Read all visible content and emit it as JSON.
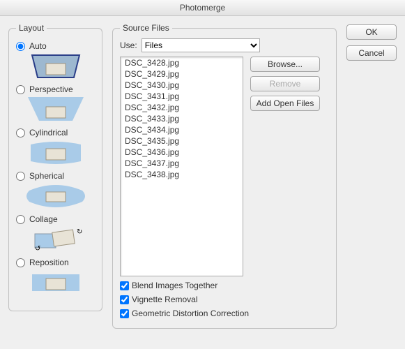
{
  "window": {
    "title": "Photomerge"
  },
  "buttons": {
    "ok": "OK",
    "cancel": "Cancel"
  },
  "layout": {
    "legend": "Layout",
    "options": {
      "auto": {
        "label": "Auto",
        "selected": true
      },
      "perspective": {
        "label": "Perspective",
        "selected": false
      },
      "cylindrical": {
        "label": "Cylindrical",
        "selected": false
      },
      "spherical": {
        "label": "Spherical",
        "selected": false
      },
      "collage": {
        "label": "Collage",
        "selected": false
      },
      "reposition": {
        "label": "Reposition",
        "selected": false
      }
    }
  },
  "source": {
    "legend": "Source Files",
    "use_label": "Use:",
    "use_value": "Files",
    "buttons": {
      "browse": "Browse...",
      "remove": "Remove",
      "add_open": "Add Open Files"
    },
    "files": [
      "DSC_3428.jpg",
      "DSC_3429.jpg",
      "DSC_3430.jpg",
      "DSC_3431.jpg",
      "DSC_3432.jpg",
      "DSC_3433.jpg",
      "DSC_3434.jpg",
      "DSC_3435.jpg",
      "DSC_3436.jpg",
      "DSC_3437.jpg",
      "DSC_3438.jpg"
    ],
    "checks": {
      "blend": {
        "label": "Blend Images Together",
        "checked": true
      },
      "vignette": {
        "label": "Vignette Removal",
        "checked": true
      },
      "geo": {
        "label": "Geometric Distortion Correction",
        "checked": true
      }
    }
  }
}
